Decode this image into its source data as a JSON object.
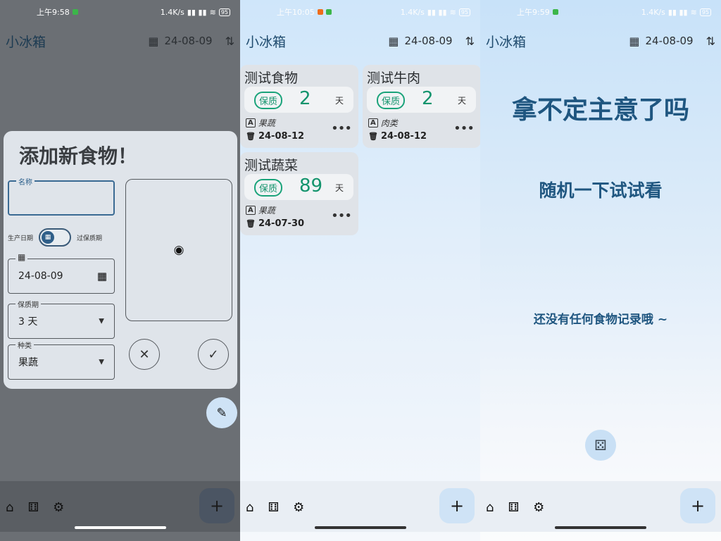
{
  "status_bars": [
    {
      "time": "上午9:58",
      "speed": "1.4K/s",
      "battery": "95"
    },
    {
      "time": "上午10:05",
      "speed": "1.4K/s",
      "battery": "95"
    },
    {
      "time": "上午9:59",
      "speed": "1.4K/s",
      "battery": "95"
    }
  ],
  "app": {
    "title": "小冰箱",
    "date": "24-08-09"
  },
  "icons": {
    "calendar": "calendar-icon",
    "sort": "sort-icon",
    "home": "home-icon",
    "dice": "dice-icon",
    "settings": "settings-icon",
    "add": "add-icon",
    "camera": "camera-icon",
    "close": "close-icon",
    "check": "check-icon",
    "edit": "edit-icon",
    "category": "category-icon",
    "trash": "trash-icon",
    "more": "more-icon"
  },
  "dialog": {
    "title": "添加新食物！",
    "name_label": "名称",
    "name_value": "",
    "toggle_left": "生产日期",
    "toggle_right": "过保质期",
    "date_value": "24-08-09",
    "shelf_label": "保质期",
    "shelf_value": "3 天",
    "category_label": "种类",
    "category_value": "果蔬"
  },
  "cards": [
    {
      "name": "测试食物",
      "badge": "保质",
      "days": "2",
      "unit": "天",
      "category": "果蔬",
      "date": "24-08-12"
    },
    {
      "name": "测试牛肉",
      "badge": "保质",
      "days": "2",
      "unit": "天",
      "category": "肉类",
      "date": "24-08-12"
    },
    {
      "name": "测试蔬菜",
      "badge": "保质",
      "days": "89",
      "unit": "天",
      "category": "果蔬",
      "date": "24-07-30"
    }
  ],
  "random_page": {
    "headline": "拿不定主意了吗",
    "subline": "随机一下试试看",
    "empty_message": "还没有任何食物记录哦 ~"
  },
  "colors": {
    "accent": "#1f5680",
    "shelf_green": "#14946d",
    "fab_bg": "#cfe3f6"
  }
}
